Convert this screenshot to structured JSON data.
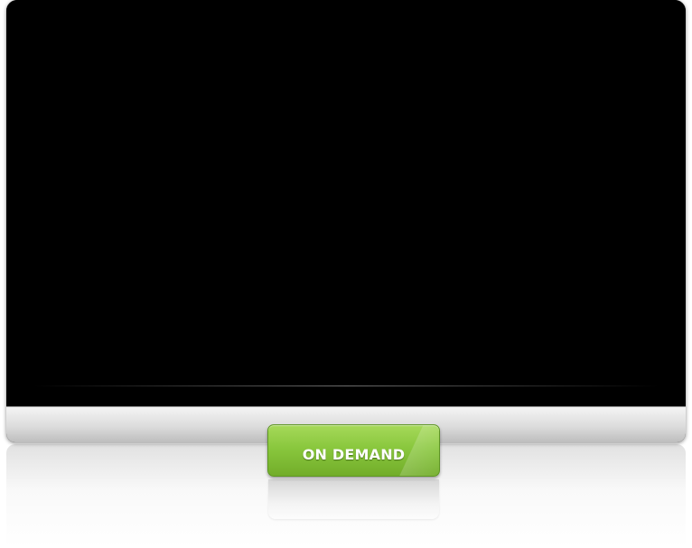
{
  "button": {
    "label": "ON DEMAND",
    "color": "#89c73d"
  },
  "device": {
    "screen_color": "#000000",
    "bezel_color": "#dcdcdc"
  }
}
